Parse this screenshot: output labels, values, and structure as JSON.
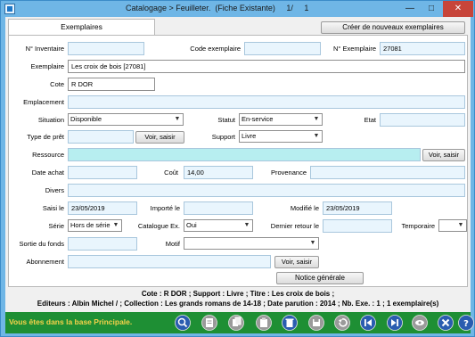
{
  "window": {
    "title": "Catalogage > Feuilleter.  (Fiche Existante)     1/     1",
    "minimize": "—",
    "maximize": "□",
    "close": "✕"
  },
  "tabs": [
    {
      "label": "Exemplaires"
    }
  ],
  "create_button": "Créer de nouveaux exemplaires",
  "form": {
    "inventaire": {
      "label": "N° Inventaire",
      "value": ""
    },
    "code_exemplaire": {
      "label": "Code exemplaire",
      "value": ""
    },
    "num_exemplaire": {
      "label": "N° Exemplaire",
      "value": "27081"
    },
    "exemplaire": {
      "label": "Exemplaire",
      "value": "Les croix de bois [27081]"
    },
    "cote": {
      "label": "Cote",
      "value": "R DOR"
    },
    "emplacement": {
      "label": "Emplacement",
      "value": ""
    },
    "situation": {
      "label": "Situation",
      "value": "Disponible"
    },
    "statut": {
      "label": "Statut",
      "value": "En-service"
    },
    "etat": {
      "label": "Etat",
      "value": ""
    },
    "type_pret": {
      "label": "Type de prêt",
      "value": "",
      "button": "Voir, saisir"
    },
    "support": {
      "label": "Support",
      "value": "Livre"
    },
    "ressource": {
      "label": "Ressource",
      "value": "",
      "button": "Voir, saisir"
    },
    "date_achat": {
      "label": "Date achat",
      "value": ""
    },
    "cout": {
      "label": "Coût",
      "value": "14,00"
    },
    "provenance": {
      "label": "Provenance",
      "value": ""
    },
    "divers": {
      "label": "Divers",
      "value": ""
    },
    "saisi_le": {
      "label": "Saisi le",
      "value": "23/05/2019"
    },
    "importe_le": {
      "label": "Importé le",
      "value": ""
    },
    "modifie_le": {
      "label": "Modifié le",
      "value": "23/05/2019"
    },
    "serie": {
      "label": "Série",
      "value": "Hors de série"
    },
    "catalogue_ex": {
      "label": "Catalogue Ex.",
      "value": "Oui"
    },
    "dernier_retour": {
      "label": "Dernier retour le",
      "value": ""
    },
    "temporaire": {
      "label": "Temporaire",
      "value": ""
    },
    "sortie_fonds": {
      "label": "Sortie du fonds",
      "value": ""
    },
    "motif": {
      "label": "Motif",
      "value": ""
    },
    "abonnement": {
      "label": "Abonnement",
      "value": "",
      "button": "Voir, saisir"
    },
    "notice_button": "Notice générale"
  },
  "info": {
    "line1": "Cote  : R DOR ;  Support  : Livre ;  Titre  : Les croix de bois ;",
    "line2": "Editeurs  : Albin Michel / ;  Collection  : Les grands romans de 14-18 ;  Date parution  : 2014 ;  Nb. Exe.  : 1 ; 1 exemplaire(s)"
  },
  "status": {
    "text": "Vous êtes dans la base Principale."
  },
  "toolbar": [
    {
      "icon": "search-icon",
      "color": "#2a5db0"
    },
    {
      "icon": "edit-icon",
      "color": "#9a9a9a"
    },
    {
      "icon": "copy-icon",
      "color": "#9a9a9a"
    },
    {
      "icon": "paste-icon",
      "color": "#9a9a9a"
    },
    {
      "icon": "delete-icon",
      "color": "#2a5db0"
    },
    {
      "icon": "save-icon",
      "color": "#9a9a9a"
    },
    {
      "icon": "undo-icon",
      "color": "#9a9a9a"
    },
    {
      "icon": "first-record-icon",
      "color": "#2a5db0"
    },
    {
      "icon": "last-record-icon",
      "color": "#2a5db0"
    },
    {
      "icon": "view-icon",
      "color": "#9a9a9a"
    },
    {
      "icon": "close-icon",
      "color": "#2a5db0"
    },
    {
      "icon": "help-icon",
      "color": "#2a5db0"
    }
  ]
}
